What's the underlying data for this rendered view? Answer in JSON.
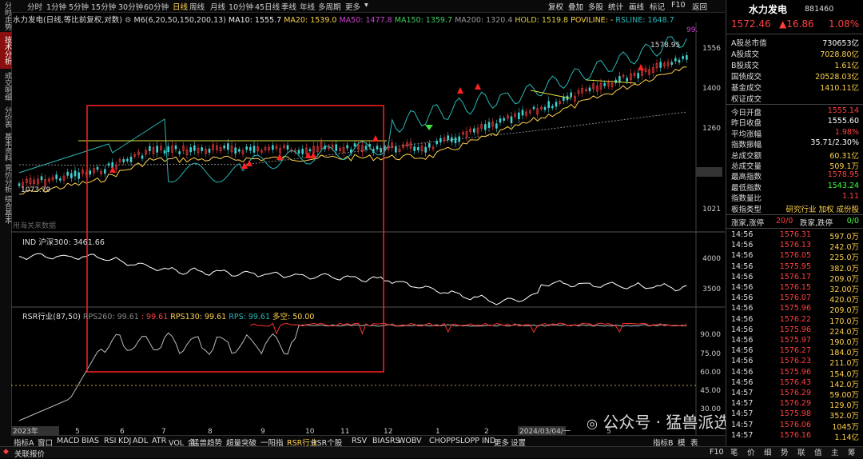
{
  "left_tabs": [
    "分时走势",
    "技术分析",
    "成交明细",
    "分价表",
    "基本资料",
    "竞价分析",
    "综合基本"
  ],
  "toolbar": {
    "periods": [
      "分时",
      "1分钟",
      "5分钟",
      "15分钟",
      "30分钟",
      "60分钟",
      "日线",
      "周线",
      "月线",
      "10分钟",
      "45日线",
      "季线",
      "年线",
      "多周期",
      "更多"
    ],
    "tools": [
      "复权",
      "叠加",
      "多股",
      "统计",
      "画线",
      "标记",
      "F10",
      "返回"
    ]
  },
  "legend_main": {
    "name": "水力发电(日线,等比前复权,对数)",
    "m6": "M6(6,20,50,150,200,13)",
    "ma10": "MA10: 1555.7",
    "ma20": "MA20: 1539.0",
    "ma50": "MA50: 1477.8",
    "ma150": "MA150: 1359.7",
    "ma200": "MA200: 1320.4",
    "hold": "HOLD: 1519.8",
    "poviline": "POVILINE: -",
    "rsline": "RSLINE: 1648.7"
  },
  "price_axis": [
    "1556",
    "1400",
    "1260",
    "1112.8",
    "1021"
  ],
  "price_marks": {
    "high": "1578.95",
    "low": "1073.79",
    "top_partial": "99."
  },
  "panel_note": "用海关来数据",
  "ind_legend": {
    "name": "IND 沪深300: 3461.66"
  },
  "ind_axis": [
    "4000",
    "3500"
  ],
  "rsr_legend": {
    "name": "RSR行业(87,50)",
    "rps260": "RPS260: 99.61",
    "rps90": ": 99.61",
    "rps130": "RPS130: 99.61",
    "rps": "RPS: 99.61",
    "duokong": "多空: 50.00"
  },
  "rsr_axis": [
    "90.00",
    "75.00",
    "60.00",
    "45.00",
    "30.00"
  ],
  "date_axis": [
    "2023年",
    "5",
    "6",
    "7",
    "8",
    "9",
    "10",
    "11",
    "12",
    "1",
    "2",
    "2024/03/04/一",
    "5"
  ],
  "bottom_tabs": [
    "指标A",
    "窗口",
    "MACD",
    "BIAS",
    "RSI",
    "KDJ",
    "ADL",
    "ATR",
    "VOL_金",
    "猛兽趋势",
    "超量突破",
    "一阳指",
    "RSR行业",
    "RSR个股",
    "RSV",
    "BIASRS",
    "WOBV",
    "CHOPP",
    "SLOPP",
    "IND",
    "更多",
    "设置"
  ],
  "bottom_right": [
    "指标B",
    "模",
    "表"
  ],
  "status": {
    "left": "关联报价",
    "right": "F10"
  },
  "stock": {
    "name": "水力发电",
    "code": "881460",
    "price": "1572.46",
    "change": "▲16.86",
    "pct": "1.08%"
  },
  "info_rows": [
    {
      "label": "A股总市值",
      "value": "730653亿",
      "color": "#ffffff"
    },
    {
      "label": "A股成交",
      "value": "7028.80亿",
      "color": "#ffd34d"
    },
    {
      "label": "B股成交",
      "value": "1.61亿",
      "color": "#ffd34d"
    },
    {
      "label": "国债成交",
      "value": "20528.03亿",
      "color": "#ffd34d"
    },
    {
      "label": "基金成交",
      "value": "1410.11亿",
      "color": "#ffd34d"
    },
    {
      "label": "权证成交",
      "value": "",
      "color": "#ffd34d"
    }
  ],
  "stat_rows": [
    {
      "label": "今日开盘",
      "value": "1555.14",
      "color": "#ff4040"
    },
    {
      "label": "昨日收盘",
      "value": "1555.60",
      "color": "#ffffff"
    },
    {
      "label": "平均涨幅",
      "value": "1.98%",
      "color": "#ff4040"
    },
    {
      "label": "指数振幅",
      "value": "35.71/2.30%",
      "color": "#ffffff"
    },
    {
      "label": "总成交额",
      "value": "60.31亿",
      "color": "#ffd34d"
    },
    {
      "label": "总成交量",
      "value": "509.1万",
      "color": "#ffd34d"
    },
    {
      "label": "最高指数",
      "value": "1578.95",
      "color": "#ff4040"
    },
    {
      "label": "最低指数",
      "value": "1543.24",
      "color": "#40ff40"
    },
    {
      "label": "指数量比",
      "value": "1.11",
      "color": "#ff4040"
    }
  ],
  "board": {
    "label": "板指类型",
    "value": "研究行业 加权 成份股"
  },
  "updown": {
    "l1": "涨家,涨停",
    "v1": "20/0",
    "l2": "跌家,跌停",
    "v2": "0/0"
  },
  "ticks": [
    {
      "t": "14:56",
      "p": "1576.31",
      "v": "597.0万"
    },
    {
      "t": "14:56",
      "p": "1576.13",
      "v": "242.0万"
    },
    {
      "t": "14:56",
      "p": "1576.05",
      "v": "225.0万"
    },
    {
      "t": "14:56",
      "p": "1575.95",
      "v": "382.0万"
    },
    {
      "t": "14:56",
      "p": "1576.17",
      "v": "209.0万"
    },
    {
      "t": "14:56",
      "p": "1576.15",
      "v": "32.00万"
    },
    {
      "t": "14:56",
      "p": "1576.07",
      "v": "420.0万"
    },
    {
      "t": "14:56",
      "p": "1575.96",
      "v": "209.0万"
    },
    {
      "t": "14:56",
      "p": "1576.22",
      "v": "170.0万"
    },
    {
      "t": "14:56",
      "p": "1575.96",
      "v": "224.0万"
    },
    {
      "t": "14:56",
      "p": "1575.97",
      "v": "190.0万"
    },
    {
      "t": "14:56",
      "p": "1576.27",
      "v": "184.0万"
    },
    {
      "t": "14:56",
      "p": "1576.23",
      "v": "211.0万"
    },
    {
      "t": "14:56",
      "p": "1575.96",
      "v": "154.0万"
    },
    {
      "t": "14:56",
      "p": "1576.43",
      "v": "142.0万"
    },
    {
      "t": "14:57",
      "p": "1576.29",
      "v": "59.00万"
    },
    {
      "t": "14:57",
      "p": "1576.29",
      "v": "129.0万"
    },
    {
      "t": "14:57",
      "p": "1575.98",
      "v": "352.0万"
    },
    {
      "t": "14:57",
      "p": "1576.06",
      "v": "1045万"
    },
    {
      "t": "14:57",
      "p": "1576.16",
      "v": "1.14亿"
    }
  ],
  "side_buttons": [
    "笔",
    "价",
    "细",
    "势",
    "联",
    "值",
    "主",
    "筹"
  ],
  "watermark": "公众号 · 猛兽派选股",
  "colors": {
    "accent_red": "#ff3030",
    "highlight_box": "#ff2020",
    "rs_line": "#2bb7b7",
    "ma_yellow": "#ffd34d"
  }
}
